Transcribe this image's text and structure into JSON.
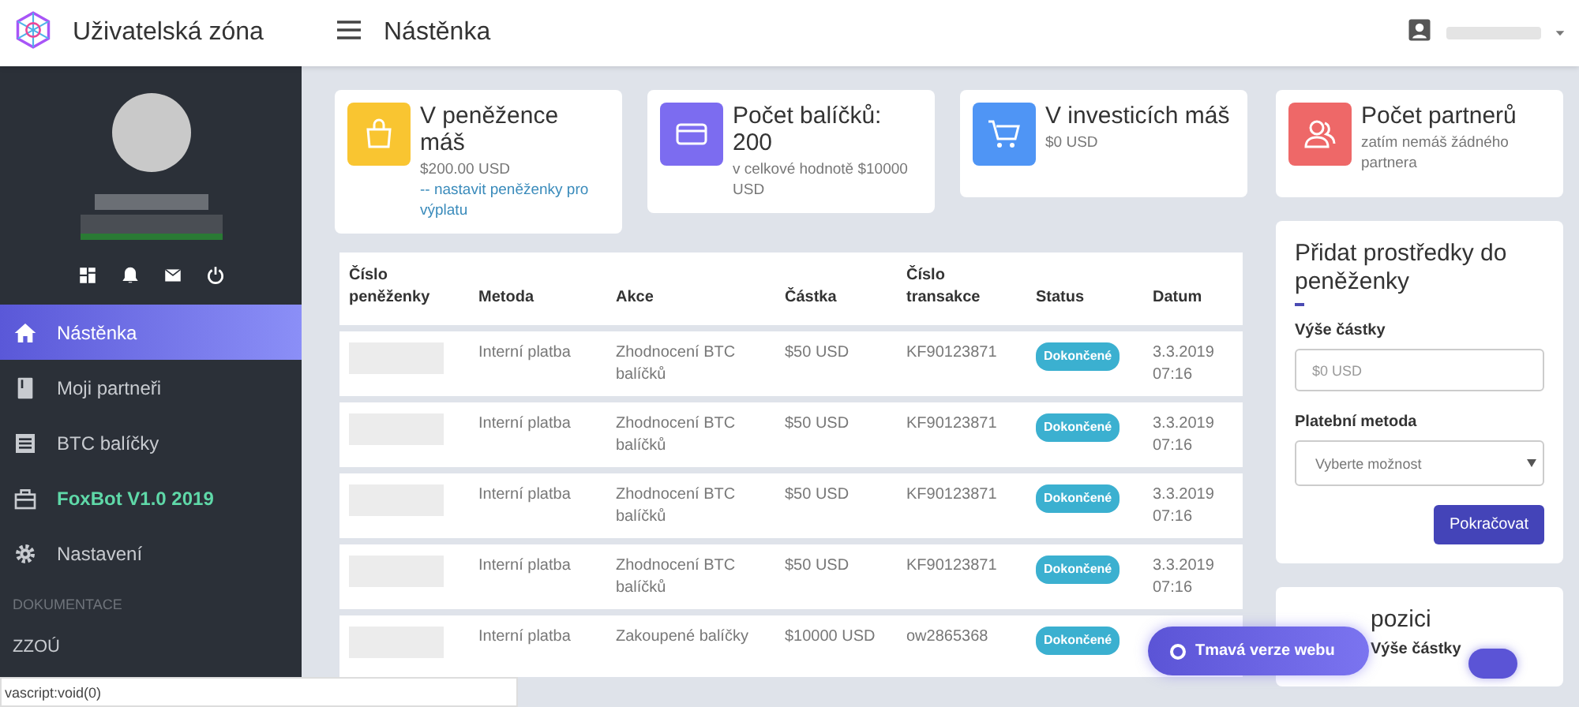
{
  "header": {
    "brand": "Uživatelská zóna",
    "page_title": "Nástěnka"
  },
  "sidebar": {
    "section_label": "DOKUMENTACE",
    "items": [
      {
        "label": "Nástěnka",
        "kind": "home",
        "selected": true,
        "accent": false
      },
      {
        "label": "Moji partneři",
        "kind": "book",
        "selected": false,
        "accent": false
      },
      {
        "label": "BTC balíčky",
        "kind": "list",
        "selected": false,
        "accent": false
      },
      {
        "label": "FoxBot V1.0 2019",
        "kind": "gift",
        "selected": false,
        "accent": true
      },
      {
        "label": "Nastavení",
        "kind": "gear",
        "selected": false,
        "accent": false
      }
    ],
    "doc_items": [
      {
        "label": "ZZOÚ"
      }
    ]
  },
  "stats": [
    {
      "title": "V peněžence máš",
      "kind": "bag",
      "color": "#f9c531",
      "text": "$200.00 USD",
      "link": "-- nastavit peněženky pro výplatu"
    },
    {
      "title": "Počet balíčků: 200",
      "kind": "card",
      "color": "#7c6cf0",
      "text": "v celkové hodnotě $10000 USD"
    },
    {
      "title": "V investicích máš",
      "kind": "cart",
      "color": "#4f95f5",
      "text": "$0 USD"
    },
    {
      "title": "Počet partnerů",
      "kind": "users",
      "color": "#ee6868",
      "text": "zatím nemáš žádného partnera"
    }
  ],
  "table": {
    "columns": [
      "Číslo peněženky",
      "Metoda",
      "Akce",
      "Částka",
      "Číslo transakce",
      "Status",
      "Datum"
    ],
    "rows": [
      {
        "method": "Interní platba",
        "action": "Zhodnocení BTC balíčků",
        "amount": "$50 USD",
        "transaction": "KF90123871",
        "status": "Dokončené",
        "date": "3.3.2019 07:16"
      },
      {
        "method": "Interní platba",
        "action": "Zhodnocení BTC balíčků",
        "amount": "$50 USD",
        "transaction": "KF90123871",
        "status": "Dokončené",
        "date": "3.3.2019 07:16"
      },
      {
        "method": "Interní platba",
        "action": "Zhodnocení BTC balíčků",
        "amount": "$50 USD",
        "transaction": "KF90123871",
        "status": "Dokončené",
        "date": "3.3.2019 07:16"
      },
      {
        "method": "Interní platba",
        "action": "Zhodnocení BTC balíčků",
        "amount": "$50 USD",
        "transaction": "KF90123871",
        "status": "Dokončené",
        "date": "3.3.2019 07:16"
      },
      {
        "method": "Interní platba",
        "action": "Zakoupené balíčky",
        "amount": "$10000 USD",
        "transaction": "ow2865368",
        "status": "Dokončené"
      }
    ]
  },
  "deposit_form": {
    "title": "Přidat prostředky do peněženky",
    "amount_label": "Výše částky",
    "amount_placeholder": "$0 USD",
    "method_label": "Platební metoda",
    "method_value": "Vyberte možnost",
    "submit": "Pokračovat"
  },
  "second_panel": {
    "title": "pozici",
    "label": "Výše částky"
  },
  "dark_mode_button": "Tmavá verze webu",
  "dark_mode_toggle": {
    "on": true
  },
  "status_bar": "vascript:void(0)"
}
